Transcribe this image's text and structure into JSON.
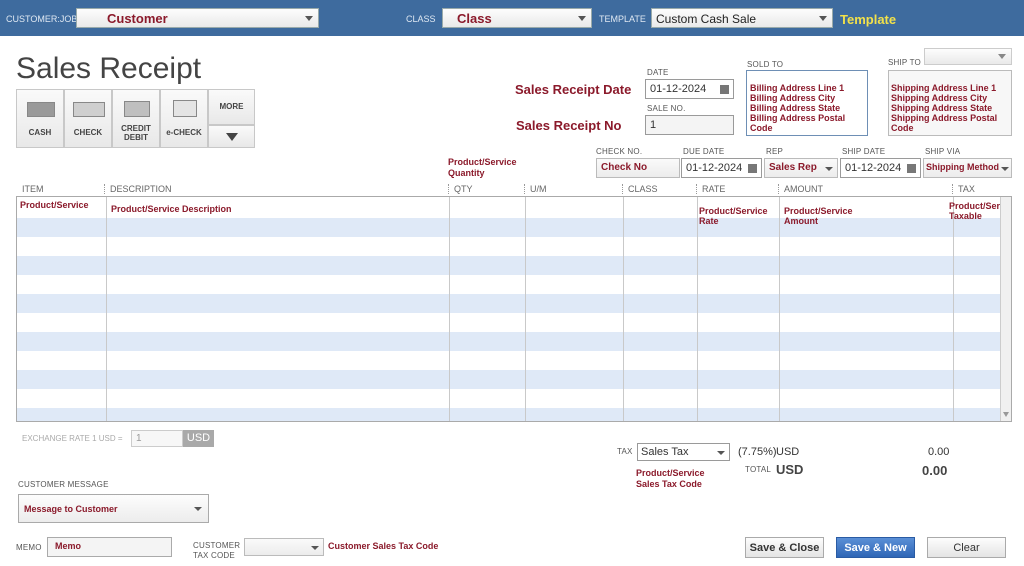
{
  "topbar": {
    "customer_job_label": "CUSTOMER:JOB",
    "customer_job_value": "Customer",
    "class_label": "CLASS",
    "class_value": "Class",
    "template_label": "TEMPLATE",
    "template_value": "Custom Cash Sale",
    "template_note": "Template"
  },
  "page_title": "Sales Receipt",
  "payment_methods": [
    {
      "label": "CASH",
      "icon": "cash-icon"
    },
    {
      "label": "CHECK",
      "icon": "check-icon"
    },
    {
      "label": "CREDIT\nDEBIT",
      "icon": "credit-card-icon"
    },
    {
      "label": "e-CHECK",
      "icon": "echeck-icon"
    }
  ],
  "more_label": "MORE",
  "header": {
    "date_note": "Sales Receipt Date",
    "date_label": "DATE",
    "date_value": "01-12-2024",
    "no_note": "Sales Receipt No",
    "no_label": "SALE NO.",
    "no_value": "1",
    "sold_to_label": "SOLD TO",
    "sold_to_lines": [
      "Billing Address Line 1",
      "Billing Address City",
      "Billing Address State",
      "Billing Address Postal Code"
    ],
    "ship_to_label": "SHIP TO",
    "ship_to_lines": [
      "Shipping Address Line 1",
      "Shipping Address City",
      "Shipping Address State",
      "Shipping Address Postal Code"
    ]
  },
  "detail_fields": {
    "check_no_label": "CHECK NO.",
    "check_no_value": "Check No",
    "due_date_label": "DUE DATE",
    "due_date_value": "01-12-2024",
    "rep_label": "REP",
    "rep_value": "Sales Rep",
    "ship_date_label": "SHIP DATE",
    "ship_date_value": "01-12-2024",
    "ship_via_label": "SHIP VIA",
    "ship_via_value": "Shipping Method",
    "qty_note": "Product/Service Quantity"
  },
  "grid": {
    "columns": [
      "ITEM",
      "DESCRIPTION",
      "QTY",
      "U/M",
      "CLASS",
      "RATE",
      "AMOUNT",
      "TAX"
    ],
    "row1": {
      "item": "Product/Service",
      "description": "Product/Service Description",
      "rate": "Product/Service Rate",
      "amount": "Product/Service Amount",
      "tax": "Product/Service Taxable"
    }
  },
  "exchange": {
    "label": "EXCHANGE RATE 1 USD =",
    "value": "1",
    "currency": "USD"
  },
  "tax": {
    "label": "TAX",
    "value": "Sales Tax",
    "rate": "(7.75%)",
    "currency": "USD",
    "amount": "0.00",
    "note": "Product/Service Sales Tax Code",
    "total_label": "TOTAL",
    "total_currency": "USD",
    "total_amount": "0.00"
  },
  "customer_message": {
    "label": "CUSTOMER MESSAGE",
    "value": "Message to Customer"
  },
  "memo": {
    "label": "MEMO",
    "value": "Memo"
  },
  "customer_tax": {
    "label_line1": "CUSTOMER",
    "label_line2": "TAX CODE",
    "note": "Customer Sales Tax Code"
  },
  "buttons": {
    "save_close": "Save & Close",
    "save_new": "Save & New",
    "clear": "Clear"
  }
}
